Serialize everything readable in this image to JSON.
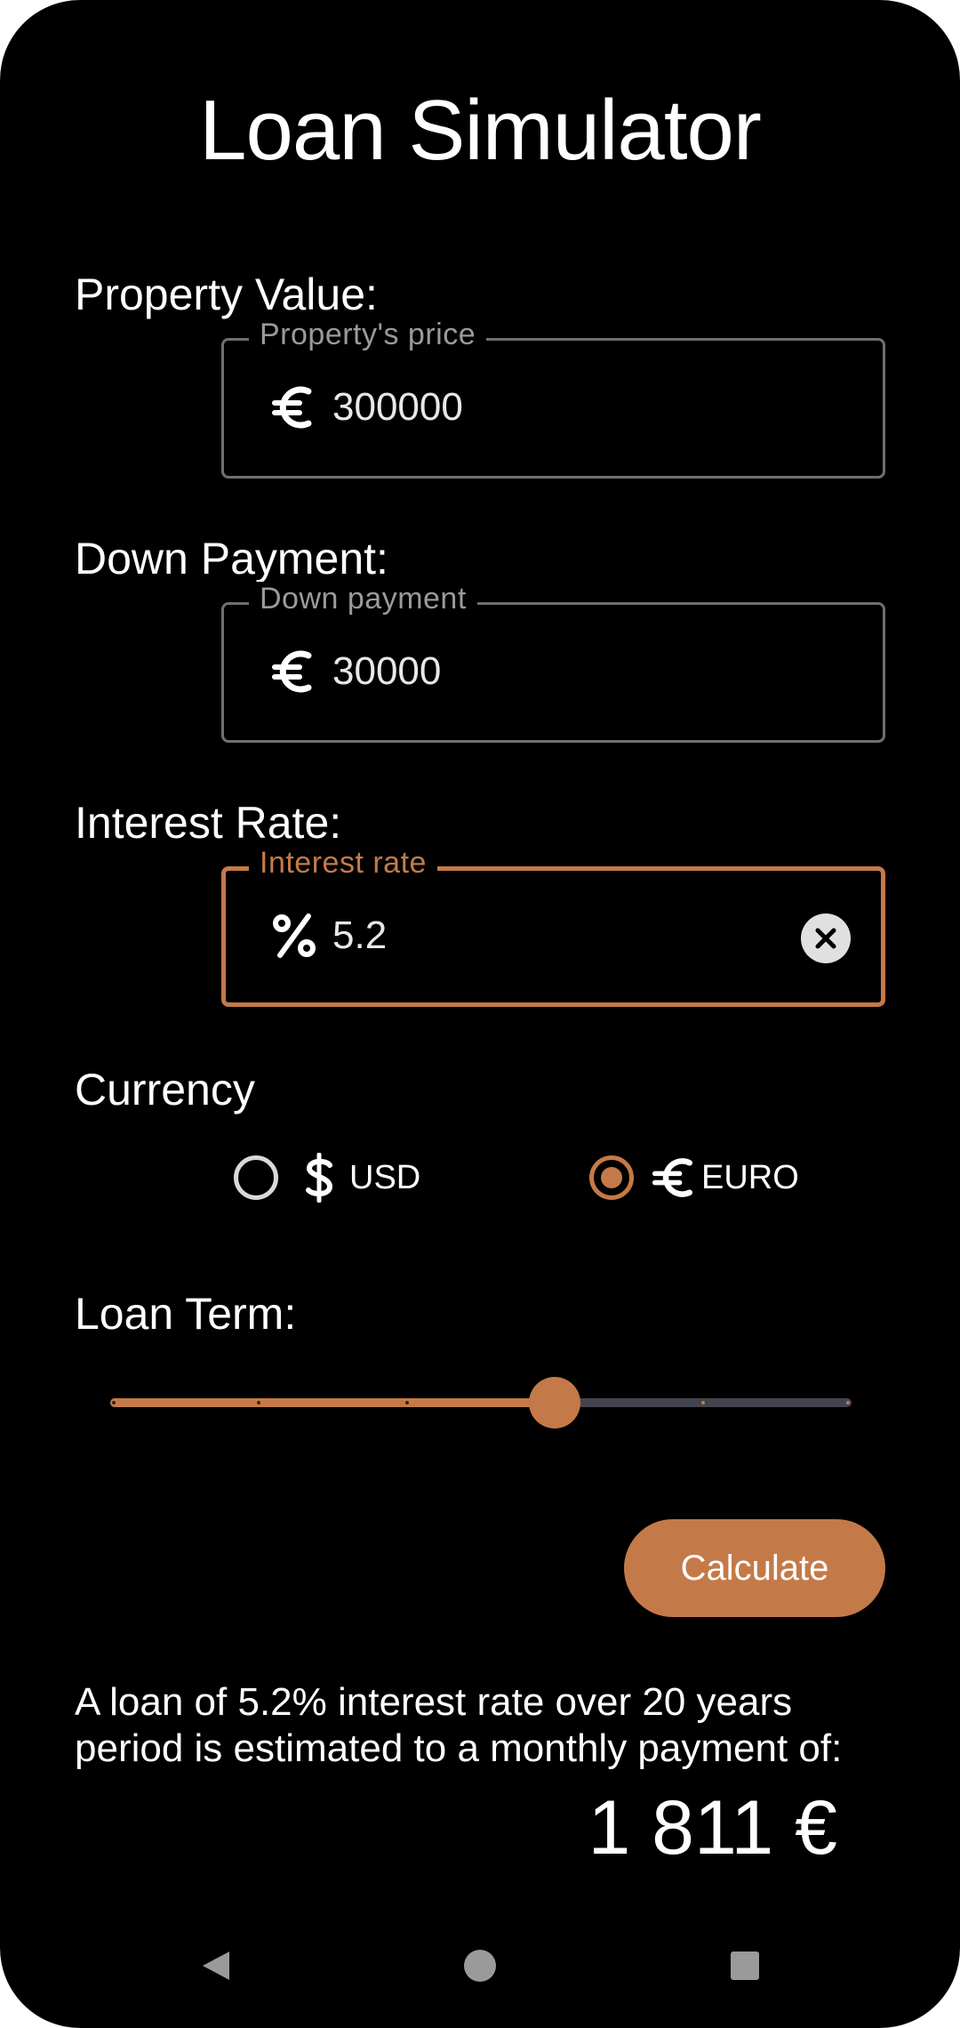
{
  "app": {
    "title": "Loan Simulator"
  },
  "property": {
    "label": "Property Value:",
    "legend": "Property's price",
    "value": "300000",
    "icon": "euro-icon"
  },
  "down_payment": {
    "label": "Down Payment:",
    "legend": "Down payment",
    "value": "30000",
    "icon": "euro-icon"
  },
  "interest": {
    "label": "Interest Rate:",
    "legend": "Interest rate",
    "value": "5.2",
    "icon": "percent-icon",
    "focused": true
  },
  "currency": {
    "label": "Currency",
    "options": [
      {
        "icon": "dollar-icon",
        "label": "USD",
        "selected": false
      },
      {
        "icon": "euro-icon",
        "label": "EURO",
        "selected": true
      }
    ]
  },
  "loan_term": {
    "label": "Loan Term:",
    "value_years": 20,
    "min_years": 5,
    "max_years": 30,
    "steps": 5
  },
  "actions": {
    "calculate_label": "Calculate"
  },
  "result": {
    "text": "A loan of 5.2% interest rate over 20 years period is estimated to a monthly payment of:",
    "amount": "1 811 €"
  },
  "colors": {
    "accent": "#c47a48",
    "background": "#000000",
    "outline": "#6f6f6f",
    "track_inactive": "#45434f"
  }
}
